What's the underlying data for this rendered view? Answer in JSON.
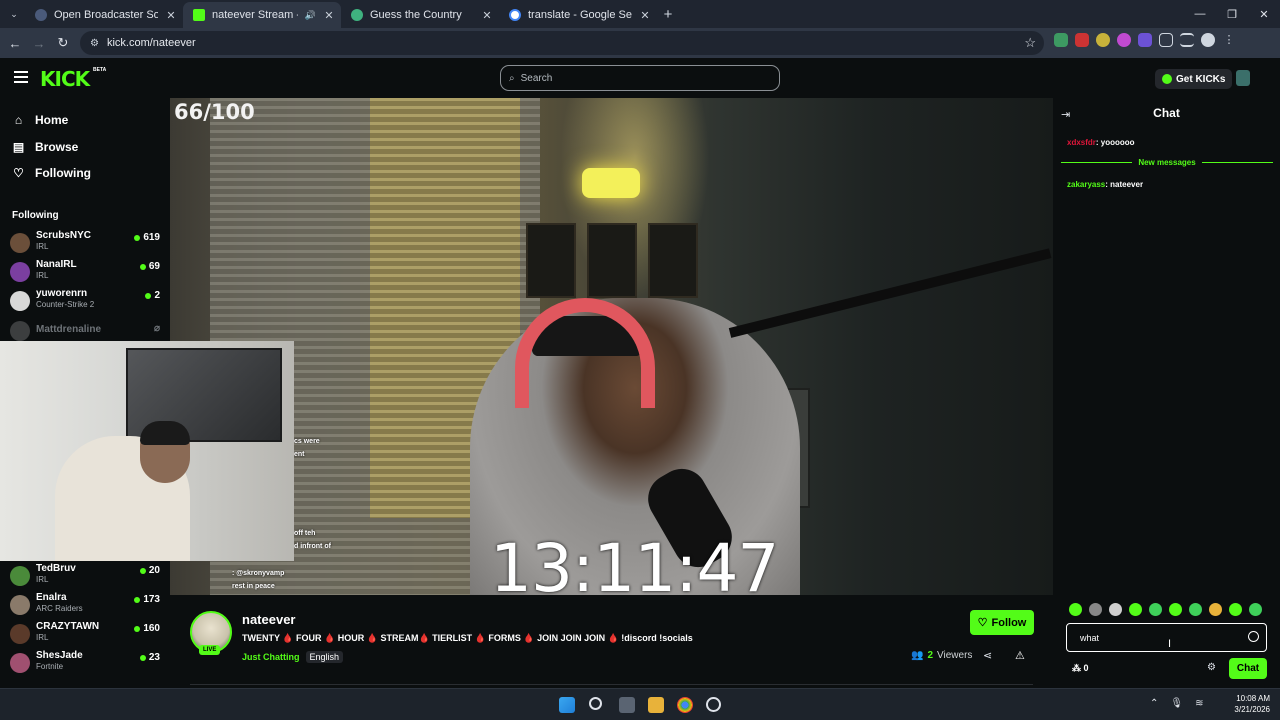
{
  "browser": {
    "tabs": [
      {
        "title": "Open Broadcaster Software | OBS",
        "favicon_color": "#4a5a7a",
        "active": false
      },
      {
        "title": "nateever Stream - Watch Live",
        "favicon_color": "#53fc18",
        "active": true
      },
      {
        "title": "Guess the Country",
        "favicon_color": "#3fb27f",
        "active": false
      },
      {
        "title": "translate - Google Search",
        "favicon_color": "#ffffff",
        "active": false
      }
    ],
    "url": "kick.com/nateever"
  },
  "kick": {
    "logo": "KICK",
    "beta": "BETA",
    "search_placeholder": "Search",
    "get_kicks": "Get KICKs"
  },
  "sidebar": {
    "nav": [
      {
        "label": "Home",
        "icon": "home-icon",
        "glyph": "⌂"
      },
      {
        "label": "Browse",
        "icon": "browse-icon",
        "glyph": "▤"
      },
      {
        "label": "Following",
        "icon": "heart-icon",
        "glyph": "♡"
      }
    ],
    "following_heading": "Following",
    "following": [
      {
        "name": "ScrubsNYC",
        "category": "IRL",
        "viewers": "619",
        "avatar_color": "#6b4f3a"
      },
      {
        "name": "NanaIRL",
        "category": "IRL",
        "viewers": "69",
        "avatar_color": "#7b3fa0"
      },
      {
        "name": "yuworenrn",
        "category": "Counter-Strike 2",
        "viewers": "2",
        "avatar_color": "#d8d8d8"
      },
      {
        "name": "Mattdrenaline",
        "category": "",
        "viewers": "",
        "avatar_color": "#888888",
        "offline": true
      }
    ],
    "following_lower": [
      {
        "name": "TedBruv",
        "category": "IRL",
        "viewers": "20",
        "avatar_color": "#4a8a3a"
      },
      {
        "name": "Enalra",
        "category": "ARC Raiders",
        "viewers": "173",
        "avatar_color": "#8a7a6a"
      },
      {
        "name": "CRAZYTAWN",
        "category": "IRL",
        "viewers": "160",
        "avatar_color": "#5a3a2a"
      },
      {
        "name": "ShesJade",
        "category": "Fortnite",
        "viewers": "23",
        "avatar_color": "#a05070"
      }
    ]
  },
  "video": {
    "counter": "66/100",
    "timer": "13:11:47",
    "overlay_lines": [
      "cs were",
      "ent",
      "off teh",
      "d infront of"
    ],
    "overlay_chat": [
      ": @skronyvamp",
      "rest in peace"
    ]
  },
  "stream": {
    "name": "nateever",
    "live_label": "LIVE",
    "title": "TWENTY 🩸 FOUR 🩸 HOUR 🩸 STREAM🩸 TIERLIST 🩸 FORMS 🩸 JOIN JOIN JOIN 🩸 !discord !socials",
    "category": "Just Chatting",
    "language": "English",
    "follow_label": "Follow",
    "viewers_count": "2",
    "viewers_label": "Viewers"
  },
  "chat": {
    "title": "Chat",
    "messages": [
      {
        "user": "xdxsfdr",
        "text": "yoooooo",
        "user_color": "#e0163a"
      },
      {
        "user": "zakaryass",
        "text": "nateever",
        "user_color": "#53fc18"
      }
    ],
    "new_messages_label": "New messages",
    "input_value": "what",
    "kicks_count": "0",
    "send_label": "Chat",
    "emote_count": 10
  },
  "taskbar": {
    "time": "10:08 AM",
    "date": "3/21/2026"
  }
}
